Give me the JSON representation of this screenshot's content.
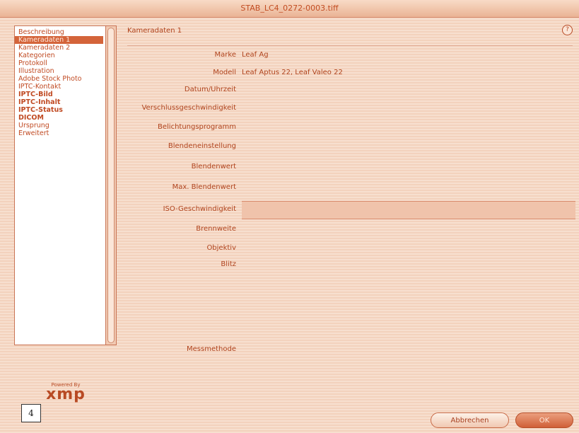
{
  "window": {
    "title": "STAB_LC4_0272-0003.tiff"
  },
  "sidebar": {
    "items": [
      {
        "label": "Beschreibung",
        "bold": false,
        "selected": false
      },
      {
        "label": "Kameradaten 1",
        "bold": false,
        "selected": true
      },
      {
        "label": "Kameradaten 2",
        "bold": false,
        "selected": false
      },
      {
        "label": "Kategorien",
        "bold": false,
        "selected": false
      },
      {
        "label": "Protokoll",
        "bold": false,
        "selected": false
      },
      {
        "label": "Illustration",
        "bold": false,
        "selected": false
      },
      {
        "label": "Adobe Stock Photo",
        "bold": false,
        "selected": false
      },
      {
        "label": "IPTC-Kontakt",
        "bold": false,
        "selected": false
      },
      {
        "label": "IPTC-Bild",
        "bold": true,
        "selected": false
      },
      {
        "label": "IPTC-Inhalt",
        "bold": true,
        "selected": false
      },
      {
        "label": "IPTC-Status",
        "bold": true,
        "selected": false
      },
      {
        "label": "DICOM",
        "bold": true,
        "selected": false
      },
      {
        "label": "Ursprung",
        "bold": false,
        "selected": false
      },
      {
        "label": "Erweitert",
        "bold": false,
        "selected": false
      }
    ]
  },
  "main": {
    "section_title": "Kameradaten 1",
    "fields": [
      {
        "label": "Marke",
        "value": "Leaf Ag"
      },
      {
        "label": "Modell",
        "value": "Leaf Aptus 22, Leaf Valeo 22"
      },
      {
        "label": "Datum/Uhrzeit",
        "value": ""
      },
      {
        "label": "Verschlussgeschwindigkeit",
        "value": ""
      },
      {
        "label": "Belichtungsprogramm",
        "value": ""
      },
      {
        "label": "Blendeneinstellung",
        "value": ""
      },
      {
        "label": "Blendenwert",
        "value": ""
      },
      {
        "label": "Max. Blendenwert",
        "value": ""
      },
      {
        "label": "ISO-Geschwindigkeit",
        "value": ""
      },
      {
        "label": "Brennweite",
        "value": ""
      },
      {
        "label": "Objektiv",
        "value": ""
      },
      {
        "label": "Blitz",
        "value": ""
      }
    ],
    "footer_label": "Messmethode"
  },
  "logo": {
    "small_text": "Powered By",
    "big_text": "xmp"
  },
  "page_number": "4",
  "buttons": {
    "cancel": "Abbrechen",
    "ok": "OK"
  },
  "colors": {
    "accent": "#d4643a",
    "text": "#b0441e",
    "background": "#f3d3bf"
  }
}
